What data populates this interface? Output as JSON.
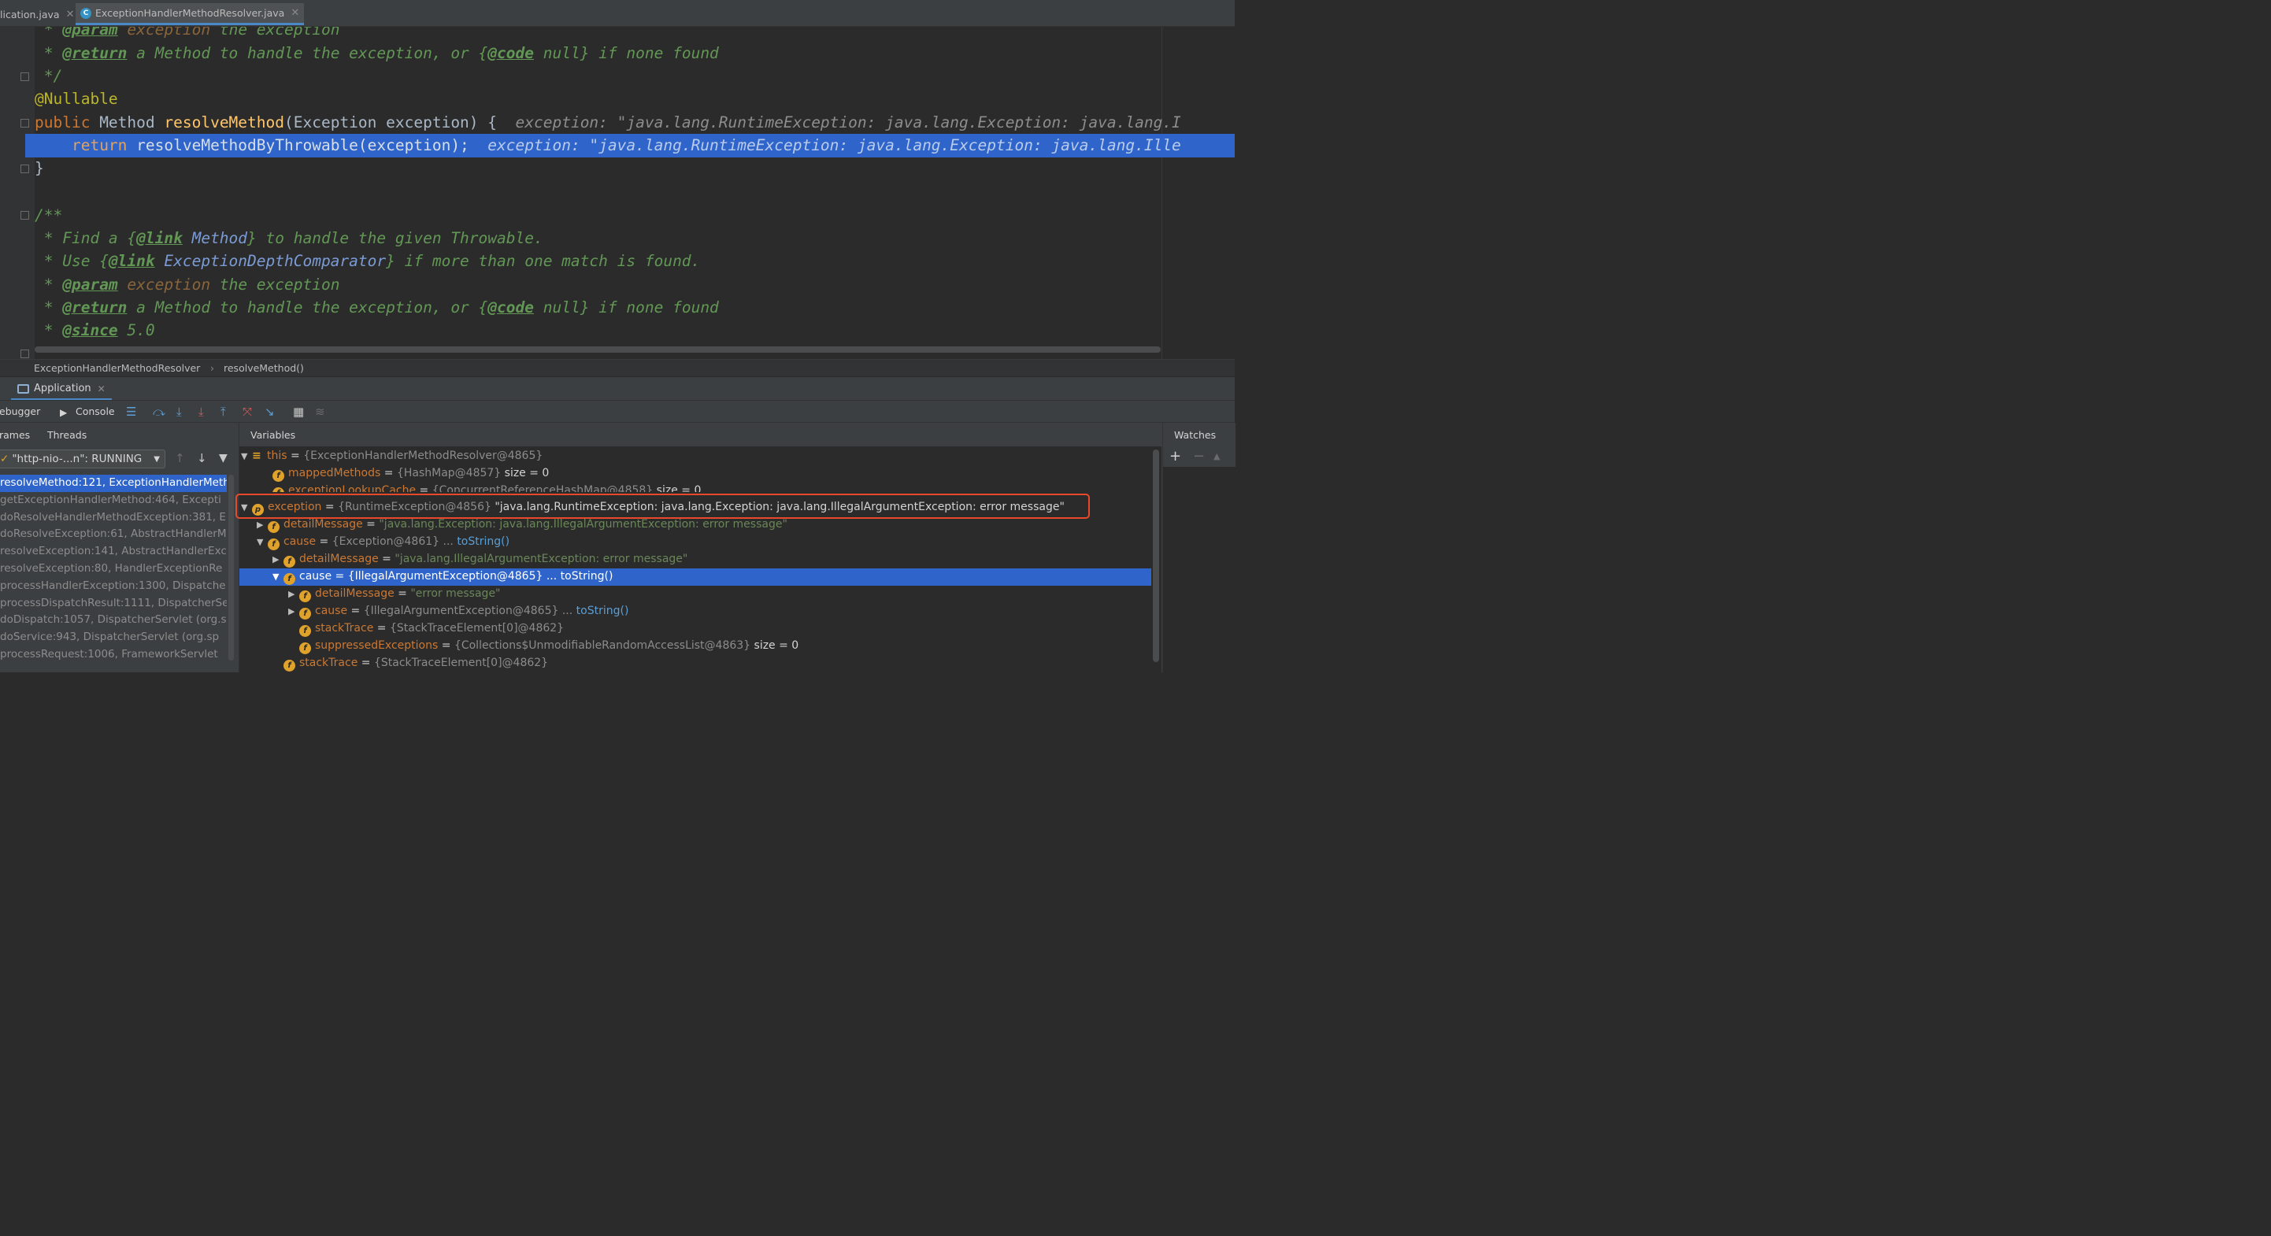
{
  "tabs": [
    {
      "label": "lication.java",
      "active": false
    },
    {
      "label": "ExceptionHandlerMethodResolver.java",
      "active": true
    }
  ],
  "code": {
    "l1": {
      "star": " * ",
      "tag": "@param",
      "param": " exception",
      "rest": " the exception"
    },
    "l2": {
      "star": " * ",
      "tag": "@return",
      "rest": " a Method to handle the exception, or {",
      "code_tag": "@code",
      "rest2": " null} if none found"
    },
    "l3": " */",
    "l4": "@Nullable",
    "l5": {
      "kw": "public",
      "type": " Method ",
      "fn": "resolveMethod",
      "args": "(Exception exception) {",
      "hint": "  exception: \"java.lang.RuntimeException: java.lang.Exception: java.lang.I"
    },
    "l6": {
      "kw": "return",
      "rest": " resolveMethodByThrowable(exception);",
      "hint": "  exception: \"java.lang.RuntimeException: java.lang.Exception: java.lang.Ille"
    },
    "l7": "}",
    "l9": "/**",
    "l10": {
      "a": " * Find a {",
      "link": "@link",
      "b": " Method",
      "c": "} to handle the given Throwable."
    },
    "l11": {
      "a": " * Use {",
      "link": "@link",
      "b": " ExceptionDepthComparator",
      "c": "} if more than one match is found."
    },
    "l12": {
      "star": " * ",
      "tag": "@param",
      "param": " exception",
      "rest": " the exception"
    },
    "l13": {
      "star": " * ",
      "tag": "@return",
      "rest": " a Method to handle the exception, or {",
      "code_tag": "@code",
      "rest2": " null} if none found"
    },
    "l14": {
      "star": " * ",
      "tag": "@since",
      "rest": " 5.0"
    }
  },
  "breadcrumb": {
    "class": "ExceptionHandlerMethodResolver",
    "sep": "›",
    "method": "resolveMethod()"
  },
  "run_tab": "Application",
  "toolbar": {
    "debugger": "ebugger",
    "console": "Console"
  },
  "frames_panel": {
    "frames_tab": "rames",
    "threads_tab": "Threads",
    "thread": "\"http-nio-...n\": RUNNING",
    "frames": [
      {
        "text": "resolveMethod:121, ExceptionHandlerMeth",
        "selected": true
      },
      {
        "text": "getExceptionHandlerMethod:464, Excepti",
        "selected": false
      },
      {
        "text": "doResolveHandlerMethodException:381, E",
        "selected": false
      },
      {
        "text": "doResolveException:61, AbstractHandlerM",
        "selected": false
      },
      {
        "text": "resolveException:141, AbstractHandlerExc",
        "selected": false
      },
      {
        "text": "resolveException:80, HandlerExceptionRe",
        "selected": false
      },
      {
        "text": "processHandlerException:1300, Dispatche",
        "selected": false
      },
      {
        "text": "processDispatchResult:1111, DispatcherSe",
        "selected": false
      },
      {
        "text": "doDispatch:1057, DispatcherServlet (org.s",
        "selected": false
      },
      {
        "text": "doService:943, DispatcherServlet (org.sp",
        "selected": false
      },
      {
        "text": "processRequest:1006, FrameworkServlet",
        "selected": false
      }
    ]
  },
  "variables_panel": {
    "title": "Variables",
    "rows": [
      {
        "name": "this",
        "eq": " = ",
        "val": "{ExceptionHandlerMethodResolver@4865}"
      },
      {
        "name": "mappedMethods",
        "eq": " = ",
        "val": "{HashMap@4857}",
        "extra": "  size = 0"
      },
      {
        "name": "exceptionLookupCache",
        "eq": " = ",
        "val": "{ConcurrentReferenceHashMap@4858}",
        "extra": "  size = 0"
      },
      {
        "name": "exception",
        "eq": " = ",
        "val": "{RuntimeException@4856}",
        "extra": " \"java.lang.RuntimeException: java.lang.Exception: java.lang.IllegalArgumentException: error message\""
      },
      {
        "name": "detailMessage",
        "eq": " = ",
        "str": "\"java.lang.Exception: java.lang.IllegalArgumentException: error message\""
      },
      {
        "name": "cause",
        "eq": " = ",
        "val": "{Exception@4861}",
        "dots": " ... ",
        "link": "toString()"
      },
      {
        "name": "detailMessage",
        "eq": " = ",
        "str": "\"java.lang.IllegalArgumentException: error message\""
      },
      {
        "name": "cause",
        "eq": " = ",
        "val": "{IllegalArgumentException@4865}",
        "dots": " ... ",
        "link": "toString()"
      },
      {
        "name": "detailMessage",
        "eq": " = ",
        "str": "\"error message\""
      },
      {
        "name": "cause",
        "eq": " = ",
        "val": "{IllegalArgumentException@4865}",
        "dots": " ... ",
        "link": "toString()"
      },
      {
        "name": "stackTrace",
        "eq": " = ",
        "val": "{StackTraceElement[0]@4862}"
      },
      {
        "name": "suppressedExceptions",
        "eq": " = ",
        "val": "{Collections$UnmodifiableRandomAccessList@4863}",
        "extra": "  size = 0"
      },
      {
        "name": "stackTrace",
        "eq": " = ",
        "val": "{StackTraceElement[0]@4862}"
      }
    ]
  },
  "watches_panel": {
    "title": "Watches"
  },
  "colors": {
    "accent": "#2f65ca",
    "highlight_box": "#e8492a"
  }
}
